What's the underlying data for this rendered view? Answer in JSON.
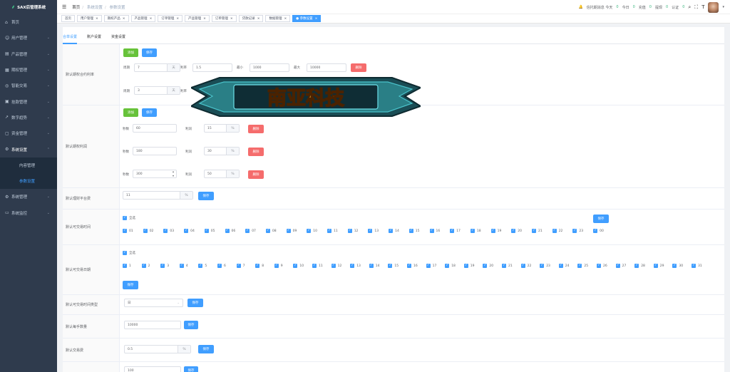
{
  "sidebar": {
    "logo": "SAX后管理系统",
    "items": [
      {
        "label": "首页",
        "icon": "home-icon",
        "glyph": "⌂"
      },
      {
        "label": "用户管理",
        "icon": "user-icon",
        "glyph": "☺"
      },
      {
        "label": "产品管理",
        "icon": "product-icon",
        "glyph": "▤"
      },
      {
        "label": "期权管理",
        "icon": "options-icon",
        "glyph": "▦"
      },
      {
        "label": "智能交易",
        "icon": "smart-trade-icon",
        "glyph": "◎"
      },
      {
        "label": "挂款管理",
        "icon": "loan-icon",
        "glyph": "▣"
      },
      {
        "label": "数字趋势",
        "icon": "trend-icon",
        "glyph": "↗"
      },
      {
        "label": "资金管理",
        "icon": "fund-icon",
        "glyph": "▢"
      },
      {
        "label": "系统设置",
        "icon": "settings-icon",
        "glyph": "⚙"
      },
      {
        "label": "系统管理",
        "icon": "system-icon",
        "glyph": "⚙"
      },
      {
        "label": "系统监控",
        "icon": "monitor-icon",
        "glyph": "▭"
      }
    ],
    "sub": [
      "内容管理",
      "参数设置"
    ]
  },
  "header": {
    "breadcrumb": [
      "首页",
      "系统设置",
      "参数设置"
    ],
    "notice": "信托期消息 今天",
    "n1": "0",
    "today": "今日",
    "n2": "0",
    "recharge": "充值",
    "n3": "0",
    "withdraw": "提现",
    "n4": "0",
    "verify": "认证",
    "n5": "0"
  },
  "tags": [
    {
      "label": "首页"
    },
    {
      "label": "用户管理"
    },
    {
      "label": "期权产品"
    },
    {
      "label": "产品管理"
    },
    {
      "label": "订单管理"
    },
    {
      "label": "产品管理"
    },
    {
      "label": "订单管理"
    },
    {
      "label": "贷款记录"
    },
    {
      "label": "数据管理"
    },
    {
      "label": "参数设置"
    }
  ],
  "tabs": [
    "合单设置",
    "账户设置",
    "资金设置"
  ],
  "common": {
    "add": "添加",
    "save": "保存",
    "del": "删除",
    "pct": "%",
    "day": "天",
    "period": "周期",
    "rate": "利率",
    "min": "最小",
    "max": "最大",
    "sec": "秒数",
    "profit": "利润"
  },
  "r1": {
    "label": "默认期权合约利率",
    "rows": [
      {
        "period": "7",
        "rate": "1.5",
        "min": "1000",
        "max": "10000"
      },
      {
        "period": "3"
      }
    ]
  },
  "r2": {
    "label": "默认期权利润",
    "rows": [
      {
        "sec": "60",
        "profit": "15"
      },
      {
        "sec": "180",
        "profit": "30"
      },
      {
        "sec": "300",
        "profit": "50"
      }
    ]
  },
  "r3": {
    "label": "默认理财平台费",
    "value": "11"
  },
  "r4": {
    "label": "默认可交易时间",
    "all": "全选",
    "items": [
      "01",
      "02",
      "03",
      "04",
      "05",
      "06",
      "07",
      "08",
      "09",
      "10",
      "11",
      "12",
      "13",
      "14",
      "15",
      "16",
      "17",
      "18",
      "19",
      "20",
      "21",
      "22",
      "23",
      "00"
    ]
  },
  "r5": {
    "label": "默认可交易日期",
    "all": "全选",
    "items": [
      "1",
      "2",
      "3",
      "4",
      "5",
      "6",
      "7",
      "8",
      "9",
      "10",
      "11",
      "12",
      "13",
      "14",
      "15",
      "16",
      "17",
      "18",
      "19",
      "20",
      "21",
      "22",
      "23",
      "24",
      "25",
      "26",
      "27",
      "28",
      "29",
      "30",
      "31"
    ]
  },
  "r6": {
    "label": "默认可交易时间类型",
    "value": "日"
  },
  "r7": {
    "label": "默认每手数量",
    "value": "10000"
  },
  "r8": {
    "label": "默认交易费",
    "value": "0.5"
  },
  "r9": {
    "value": "100"
  },
  "banner": {
    "text": "南亚科技"
  }
}
